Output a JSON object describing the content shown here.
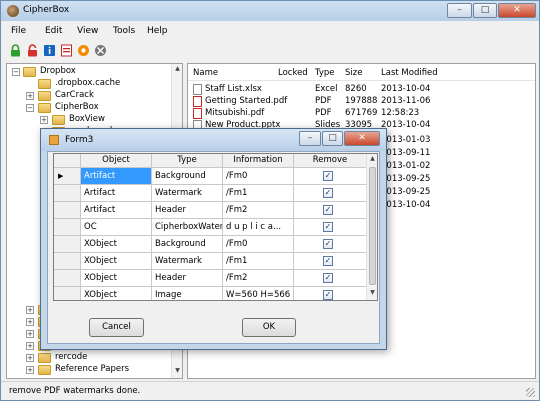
{
  "window": {
    "title": "CipherBox",
    "minimize": "–",
    "maximize": "□",
    "close": "✕"
  },
  "menu": [
    "File",
    "Edit",
    "View",
    "Tools",
    "Help"
  ],
  "toolbar": [
    {
      "icon": "green-lock-icon",
      "color": "#2e9e2e"
    },
    {
      "icon": "red-unlock-icon",
      "color": "#d32f2f"
    },
    {
      "icon": "info-icon",
      "color": "#1565c0"
    },
    {
      "icon": "pdf-tool-icon",
      "color": "#c62828"
    },
    {
      "icon": "orange-gear-icon",
      "color": "#f08a00"
    },
    {
      "icon": "tools-icon",
      "color": "#555555"
    }
  ],
  "tree": {
    "items": [
      {
        "label": "Dropbox",
        "expander": "−"
      },
      {
        "label": ".dropbox.cache",
        "expander": ""
      },
      {
        "label": "CarCrack",
        "expander": "+"
      },
      {
        "label": "CipherBox",
        "expander": "−"
      },
      {
        "label": "BoxView",
        "expander": "+"
      },
      {
        "label": "crack_and",
        "expander": ""
      }
    ],
    "bottom_items": [
      {
        "label": "rercode",
        "expander": "+"
      },
      {
        "label": "Reference Papers",
        "expander": "+"
      }
    ]
  },
  "filelist": {
    "columns": [
      "Name",
      "Locked",
      "Type",
      "Size",
      "Last Modified"
    ],
    "rows": [
      {
        "name": "Staff List.xlsx",
        "locked": "",
        "type": "Excel",
        "size": "8260",
        "modified": "2013-10-04",
        "kind": "doc"
      },
      {
        "name": "Getting Started.pdf",
        "locked": "",
        "type": "PDF",
        "size": "197888",
        "modified": "2013-11-06",
        "kind": "pdf"
      },
      {
        "name": "Mitsubishi.pdf",
        "locked": "",
        "type": "PDF",
        "size": "671769",
        "modified": "12:58:23",
        "kind": "pdf"
      },
      {
        "name": "New Product.pptx",
        "locked": "",
        "type": "Slides",
        "size": "33095",
        "modified": "2013-10-04",
        "kind": "doc"
      }
    ],
    "more_dates": [
      "2013-01-03",
      "2013-09-11",
      "2013-01-02",
      "2013-09-25",
      "2013-09-25",
      "2013-10-04"
    ]
  },
  "status": {
    "text": "remove PDF watermarks done."
  },
  "dialog": {
    "title": "Form3",
    "columns": [
      "Object",
      "Type",
      "Information",
      "Remove"
    ],
    "rows": [
      {
        "object": "Artifact",
        "type": "Background",
        "info": "/Fm0",
        "remove": true,
        "current": true
      },
      {
        "object": "Artifact",
        "type": "Watermark",
        "info": "/Fm1",
        "remove": true,
        "current": false
      },
      {
        "object": "Artifact",
        "type": "Header",
        "info": "/Fm2",
        "remove": true,
        "current": false
      },
      {
        "object": "OC",
        "type": "CipherboxWater...",
        "info": "d u p l i c a...",
        "remove": true,
        "current": false
      },
      {
        "object": "XObject",
        "type": "Background",
        "info": "/Fm0",
        "remove": true,
        "current": false
      },
      {
        "object": "XObject",
        "type": "Watermark",
        "info": "/Fm1",
        "remove": true,
        "current": false
      },
      {
        "object": "XObject",
        "type": "Header",
        "info": "/Fm2",
        "remove": true,
        "current": false
      },
      {
        "object": "XObject",
        "type": "Image",
        "info": "W=560 H=566",
        "remove": true,
        "current": false
      }
    ],
    "cancel_label": "Cancel",
    "ok_label": "OK",
    "current_row_marker": "▶",
    "check_mark": "✓"
  },
  "colors": {
    "selection": "#3399ff",
    "title_gradient": "#b9d0e9"
  }
}
